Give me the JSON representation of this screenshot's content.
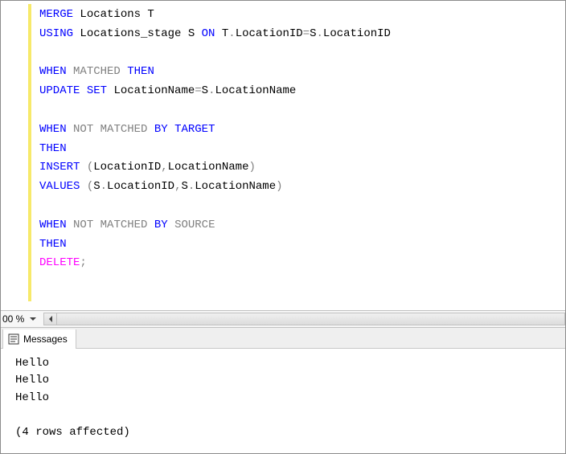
{
  "editor": {
    "lines": [
      [
        [
          "kw",
          "MERGE"
        ],
        [
          "plain",
          " Locations T"
        ]
      ],
      [
        [
          "kw",
          "USING"
        ],
        [
          "plain",
          " Locations_stage S "
        ],
        [
          "kw",
          "ON"
        ],
        [
          "plain",
          " T"
        ],
        [
          "grey",
          "."
        ],
        [
          "plain",
          "LocationID"
        ],
        [
          "grey",
          "="
        ],
        [
          "plain",
          "S"
        ],
        [
          "grey",
          "."
        ],
        [
          "plain",
          "LocationID"
        ]
      ],
      [],
      [
        [
          "kw",
          "WHEN"
        ],
        [
          "plain",
          " "
        ],
        [
          "grey",
          "MATCHED"
        ],
        [
          "plain",
          " "
        ],
        [
          "kw",
          "THEN"
        ]
      ],
      [
        [
          "kw",
          "UPDATE"
        ],
        [
          "plain",
          " "
        ],
        [
          "kw",
          "SET"
        ],
        [
          "plain",
          " LocationName"
        ],
        [
          "grey",
          "="
        ],
        [
          "plain",
          "S"
        ],
        [
          "grey",
          "."
        ],
        [
          "plain",
          "LocationName"
        ]
      ],
      [],
      [
        [
          "kw",
          "WHEN"
        ],
        [
          "plain",
          " "
        ],
        [
          "grey",
          "NOT"
        ],
        [
          "plain",
          " "
        ],
        [
          "grey",
          "MATCHED"
        ],
        [
          "plain",
          " "
        ],
        [
          "kw",
          "BY"
        ],
        [
          "plain",
          " "
        ],
        [
          "kw",
          "TARGET"
        ]
      ],
      [
        [
          "kw",
          "THEN"
        ]
      ],
      [
        [
          "kw",
          "INSERT"
        ],
        [
          "plain",
          " "
        ],
        [
          "grey",
          "("
        ],
        [
          "plain",
          "LocationID"
        ],
        [
          "grey",
          ","
        ],
        [
          "plain",
          "LocationName"
        ],
        [
          "grey",
          ")"
        ]
      ],
      [
        [
          "kw",
          "VALUES"
        ],
        [
          "plain",
          " "
        ],
        [
          "grey",
          "("
        ],
        [
          "plain",
          "S"
        ],
        [
          "grey",
          "."
        ],
        [
          "plain",
          "LocationID"
        ],
        [
          "grey",
          ","
        ],
        [
          "plain",
          "S"
        ],
        [
          "grey",
          "."
        ],
        [
          "plain",
          "LocationName"
        ],
        [
          "grey",
          ")"
        ]
      ],
      [],
      [
        [
          "kw",
          "WHEN"
        ],
        [
          "plain",
          " "
        ],
        [
          "grey",
          "NOT"
        ],
        [
          "plain",
          " "
        ],
        [
          "grey",
          "MATCHED"
        ],
        [
          "plain",
          " "
        ],
        [
          "kw",
          "BY"
        ],
        [
          "plain",
          " "
        ],
        [
          "grey",
          "SOURCE"
        ]
      ],
      [
        [
          "kw",
          "THEN"
        ]
      ],
      [
        [
          "pink",
          "DELETE"
        ],
        [
          "grey",
          ";"
        ]
      ]
    ]
  },
  "zoom": {
    "value": "00 %"
  },
  "tab": {
    "label": "Messages"
  },
  "messages": {
    "lines": [
      "Hello",
      "Hello",
      "Hello",
      "",
      "(4 rows affected)"
    ]
  }
}
